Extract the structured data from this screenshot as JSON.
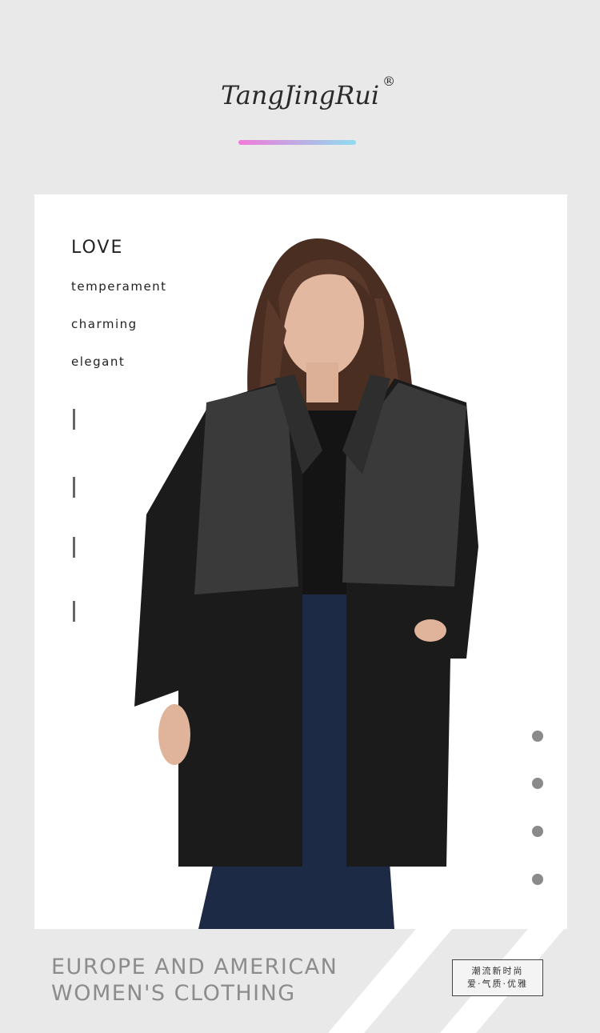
{
  "brand": {
    "name": "TangJingRui",
    "registered_mark": "®",
    "bar_gradient_start": "#f07ad8",
    "bar_gradient_end": "#8fdcef"
  },
  "card": {
    "heading": "LOVE",
    "words": [
      "temperament",
      "charming",
      "elegant"
    ]
  },
  "tagline": {
    "line1": "EUROPE AND AMERICAN",
    "line2": "WOMEN'S CLOTHING"
  },
  "stamp": {
    "line1": "潮流新时尚",
    "line2": "爱·气质·优雅"
  },
  "colors": {
    "page_background": "#e9e9e9",
    "card_background": "#ffffff",
    "tagline_text": "#8c8c8c",
    "indicator_dot": "#8a8a8a"
  },
  "icons": {
    "ticks": "vertical-tick-marks",
    "dots": "indicator-dots"
  }
}
